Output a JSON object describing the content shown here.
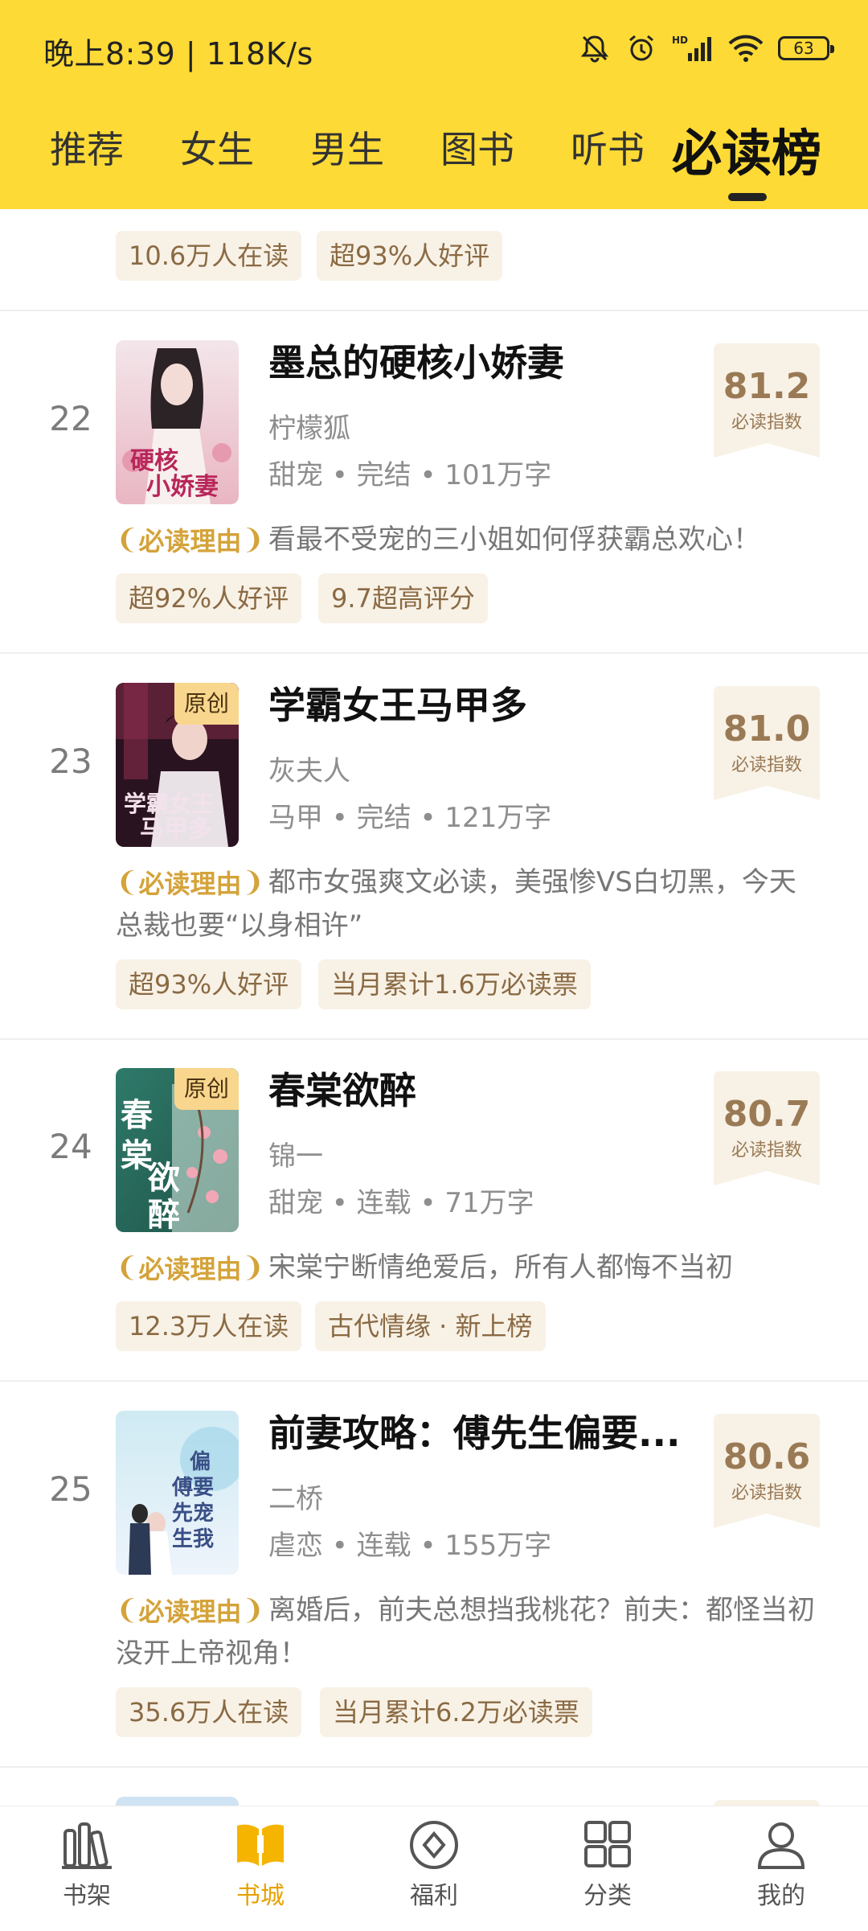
{
  "status_bar": {
    "time": "晚上8:39 | 118K/s",
    "battery": "63"
  },
  "top_tabs": [
    "推荐",
    "女生",
    "男生",
    "图书",
    "听书",
    "必读榜"
  ],
  "active_tab": "必读榜",
  "reason_label": "必读理由",
  "partial_top_tags": [
    "10.6万人在读",
    "超93%人好评"
  ],
  "books": [
    {
      "rank": "22",
      "title": "墨总的硬核小娇妻",
      "author": "柠檬狐",
      "meta": "甜宠 • 完结 • 101万字",
      "score": "81.2",
      "score_label": "必读指数",
      "badge": "",
      "reason": "看最不受宠的三小姐如何俘获霸总欢心！",
      "tags": [
        "超92%人好评",
        "9.7超高评分"
      ]
    },
    {
      "rank": "23",
      "title": "学霸女王马甲多",
      "author": "灰夫人",
      "meta": "马甲 • 完结 • 121万字",
      "score": "81.0",
      "score_label": "必读指数",
      "badge": "原创",
      "reason": "都市女强爽文必读，美强惨VS白切黑，今天总裁也要“以身相许”",
      "tags": [
        "超93%人好评",
        "当月累计1.6万必读票"
      ]
    },
    {
      "rank": "24",
      "title": "春棠欲醉",
      "author": "锦一",
      "meta": "甜宠 • 连载 • 71万字",
      "score": "80.7",
      "score_label": "必读指数",
      "badge": "原创",
      "reason": "宋棠宁断情绝爱后，所有人都悔不当初",
      "tags": [
        "12.3万人在读",
        "古代情缘 · 新上榜"
      ]
    },
    {
      "rank": "25",
      "title": "前妻攻略：傅先生偏要...",
      "author": "二桥",
      "meta": "虐恋 • 连载 • 155万字",
      "score": "80.6",
      "score_label": "必读指数",
      "badge": "",
      "reason": "离婚后，前夫总想挡我桃花？前夫：都怪当初没开上帝视角！",
      "tags": [
        "35.6万人在读",
        "当月累计6.2万必读票"
      ]
    }
  ],
  "bottom_nav": [
    {
      "label": "书架",
      "icon": "bookshelf-icon"
    },
    {
      "label": "书城",
      "icon": "bookstore-icon"
    },
    {
      "label": "福利",
      "icon": "welfare-icon"
    },
    {
      "label": "分类",
      "icon": "category-icon"
    },
    {
      "label": "我的",
      "icon": "profile-icon"
    }
  ],
  "active_nav": "书城",
  "colors": {
    "header": "#FDDA35",
    "tag_bg": "#F8F1E6",
    "tag_text": "#8a6a43",
    "reason_gold": "#d4a33a",
    "nav_active": "#E6A100"
  }
}
